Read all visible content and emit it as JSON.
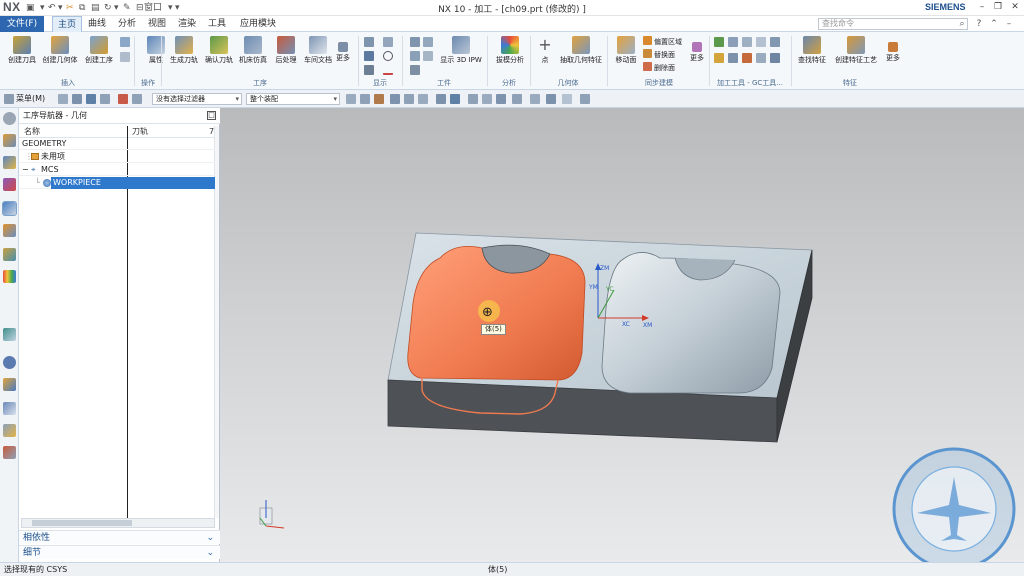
{
  "app": {
    "logo": "NX",
    "window_title": "NX 10 - 加工 - [ch09.prt  (修改的) ]",
    "brand": "SIEMENS",
    "quick_access": {
      "window_menu": "窗口"
    }
  },
  "menu": {
    "file": "文件(F)",
    "tabs": [
      "主页",
      "曲线",
      "分析",
      "视图",
      "渲染",
      "工具",
      "应用模块"
    ],
    "active_tab": "主页",
    "search_placeholder": "查找命令"
  },
  "ribbon": {
    "insert": {
      "label": "插入",
      "buttons": [
        "创建刀具",
        "创建几何体",
        "创建工序"
      ]
    },
    "operation": {
      "label": "操作",
      "buttons": [
        "属性"
      ]
    },
    "process": {
      "label": "工序",
      "buttons": [
        "生成刀轨",
        "确认刀轨",
        "机床仿真",
        "后处理",
        "车间文档",
        "更多"
      ]
    },
    "display": {
      "label": "显示"
    },
    "workpiece": {
      "label": "工件",
      "buttons": [
        "显示 3D IPW"
      ]
    },
    "analysis": {
      "label": "分析",
      "buttons": [
        "拔模分析"
      ]
    },
    "geometry_body": {
      "label": "几何体",
      "buttons": [
        "点",
        "抽取几何特征"
      ]
    },
    "sync_modeling": {
      "label": "同步建模",
      "buttons": [
        "移动面"
      ],
      "small": [
        "偏置区域",
        "替换面",
        "删除面"
      ],
      "more": "更多"
    },
    "gc_tools": {
      "label": "加工工具 - GC工具..."
    },
    "feature": {
      "label": "特征",
      "buttons": [
        "查找特征",
        "创建特征工艺",
        "更多"
      ]
    }
  },
  "selection_bar": {
    "menu": "菜单(M)",
    "filter": "没有选择过滤器",
    "scope": "整个装配"
  },
  "navigator": {
    "title": "工序导航器 - 几何",
    "columns": [
      "名称",
      "刀轨",
      "7"
    ],
    "rows": [
      {
        "name": "GEOMETRY",
        "level": 0,
        "icon": ""
      },
      {
        "name": "未用项",
        "level": 1,
        "icon": "unused-folder-icon"
      },
      {
        "name": "MCS",
        "level": 1,
        "icon": "mcs-icon",
        "expander": "−"
      },
      {
        "name": "WORKPIECE",
        "level": 2,
        "icon": "workpiece-icon",
        "selected": true
      }
    ],
    "panels": [
      "相依性",
      "细节"
    ]
  },
  "viewport": {
    "tooltip": "体(5)",
    "axes": {
      "zm": "ZM",
      "ym": "YM",
      "xm": "XM",
      "yc": "YC",
      "xc": "XC"
    },
    "colors": {
      "highlight": "#f07a4f",
      "block_top": "#c9d3da",
      "block_side": "#4e5256",
      "cavity": "#b7c3cc"
    }
  },
  "status": {
    "left": "选择现有的 CSYS",
    "center": "体(5)"
  }
}
